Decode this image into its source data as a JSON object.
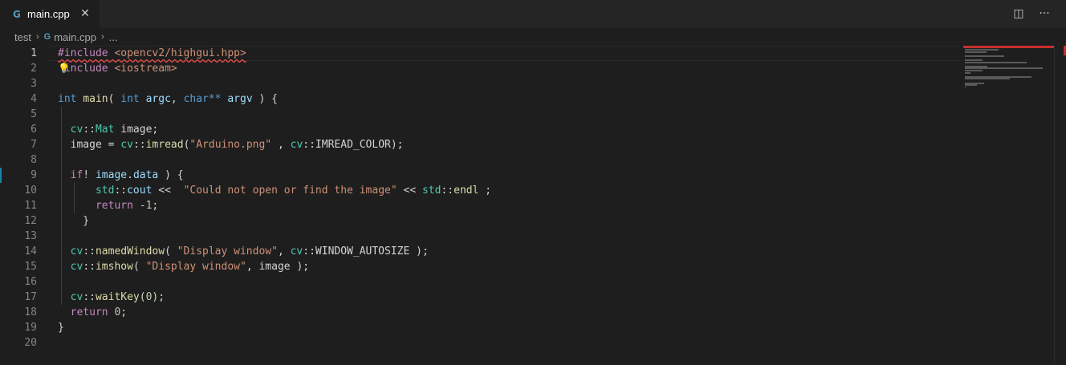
{
  "tab": {
    "icon": "cpp-file-icon",
    "icon_glyph": "G",
    "label": "main.cpp",
    "close_glyph": "✕"
  },
  "actions": {
    "split_glyph": "◫",
    "more_glyph": "···"
  },
  "breadcrumb": {
    "folder": "test",
    "file_icon_glyph": "G",
    "file": "main.cpp",
    "sep": "›",
    "ellipsis": "..."
  },
  "editor": {
    "line_numbers": [
      "1",
      "2",
      "3",
      "4",
      "5",
      "6",
      "7",
      "8",
      "9",
      "10",
      "11",
      "12",
      "13",
      "14",
      "15",
      "16",
      "17",
      "18",
      "19",
      "20"
    ],
    "active_line": "1",
    "lightbulb_glyph": "💡",
    "lines": [
      [
        {
          "t": "#include ",
          "c": "kw-dir sq"
        },
        {
          "t": "<opencv2/highgui.hpp>",
          "c": "str sq"
        }
      ],
      [
        {
          "t": " include ",
          "c": "kw-dir"
        },
        {
          "t": "<iostream>",
          "c": "str"
        }
      ],
      [],
      [
        {
          "t": "int",
          "c": "type"
        },
        {
          "t": " ",
          "c": "plain"
        },
        {
          "t": "main",
          "c": "fn"
        },
        {
          "t": "( ",
          "c": "plain"
        },
        {
          "t": "int",
          "c": "type"
        },
        {
          "t": " ",
          "c": "plain"
        },
        {
          "t": "argc",
          "c": "var"
        },
        {
          "t": ", ",
          "c": "plain"
        },
        {
          "t": "char**",
          "c": "type"
        },
        {
          "t": " ",
          "c": "plain"
        },
        {
          "t": "argv",
          "c": "var"
        },
        {
          "t": " ) {",
          "c": "plain"
        }
      ],
      [],
      [
        {
          "t": "  ",
          "c": "plain"
        },
        {
          "t": "cv",
          "c": "ns"
        },
        {
          "t": "::",
          "c": "plain"
        },
        {
          "t": "Mat",
          "c": "ns"
        },
        {
          "t": " image;",
          "c": "plain"
        }
      ],
      [
        {
          "t": "  image = ",
          "c": "plain"
        },
        {
          "t": "cv",
          "c": "ns"
        },
        {
          "t": "::",
          "c": "plain"
        },
        {
          "t": "imread",
          "c": "fn"
        },
        {
          "t": "(",
          "c": "plain"
        },
        {
          "t": "\"Arduino.png\"",
          "c": "str"
        },
        {
          "t": " , ",
          "c": "plain"
        },
        {
          "t": "cv",
          "c": "ns"
        },
        {
          "t": "::IMREAD_COLOR);",
          "c": "plain"
        }
      ],
      [],
      [
        {
          "t": "  ",
          "c": "plain"
        },
        {
          "t": "if",
          "c": "ctl"
        },
        {
          "t": "! ",
          "c": "plain"
        },
        {
          "t": "image",
          "c": "var"
        },
        {
          "t": ".",
          "c": "plain"
        },
        {
          "t": "data",
          "c": "var"
        },
        {
          "t": " ) {",
          "c": "plain"
        }
      ],
      [
        {
          "t": "      ",
          "c": "plain"
        },
        {
          "t": "std",
          "c": "ns"
        },
        {
          "t": "::",
          "c": "plain"
        },
        {
          "t": "cout",
          "c": "var"
        },
        {
          "t": " <<  ",
          "c": "plain"
        },
        {
          "t": "\"Could not open or find the image\"",
          "c": "str"
        },
        {
          "t": " << ",
          "c": "plain"
        },
        {
          "t": "std",
          "c": "ns"
        },
        {
          "t": "::",
          "c": "plain"
        },
        {
          "t": "endl",
          "c": "fn"
        },
        {
          "t": " ;",
          "c": "plain"
        }
      ],
      [
        {
          "t": "      ",
          "c": "plain"
        },
        {
          "t": "return",
          "c": "ctl"
        },
        {
          "t": " -",
          "c": "plain"
        },
        {
          "t": "1",
          "c": "num"
        },
        {
          "t": ";",
          "c": "plain"
        }
      ],
      [
        {
          "t": "    }",
          "c": "plain"
        }
      ],
      [],
      [
        {
          "t": "  ",
          "c": "plain"
        },
        {
          "t": "cv",
          "c": "ns"
        },
        {
          "t": "::",
          "c": "plain"
        },
        {
          "t": "namedWindow",
          "c": "fn"
        },
        {
          "t": "( ",
          "c": "plain"
        },
        {
          "t": "\"Display window\"",
          "c": "str"
        },
        {
          "t": ", ",
          "c": "plain"
        },
        {
          "t": "cv",
          "c": "ns"
        },
        {
          "t": "::WINDOW_AUTOSIZE );",
          "c": "plain"
        }
      ],
      [
        {
          "t": "  ",
          "c": "plain"
        },
        {
          "t": "cv",
          "c": "ns"
        },
        {
          "t": "::",
          "c": "plain"
        },
        {
          "t": "imshow",
          "c": "fn"
        },
        {
          "t": "( ",
          "c": "plain"
        },
        {
          "t": "\"Display window\"",
          "c": "str"
        },
        {
          "t": ", image );",
          "c": "plain"
        }
      ],
      [],
      [
        {
          "t": "  ",
          "c": "plain"
        },
        {
          "t": "cv",
          "c": "ns"
        },
        {
          "t": "::",
          "c": "plain"
        },
        {
          "t": "waitKey",
          "c": "fn"
        },
        {
          "t": "(",
          "c": "plain"
        },
        {
          "t": "0",
          "c": "num"
        },
        {
          "t": ");",
          "c": "plain"
        }
      ],
      [
        {
          "t": "  ",
          "c": "plain"
        },
        {
          "t": "return",
          "c": "ctl"
        },
        {
          "t": " ",
          "c": "plain"
        },
        {
          "t": "0",
          "c": "num"
        },
        {
          "t": ";",
          "c": "plain"
        }
      ],
      [
        {
          "t": "}",
          "c": "plain"
        }
      ],
      []
    ]
  },
  "colors": {
    "background": "#1e1e1e",
    "error": "#f14c4c",
    "modified": "#1b81a8"
  }
}
